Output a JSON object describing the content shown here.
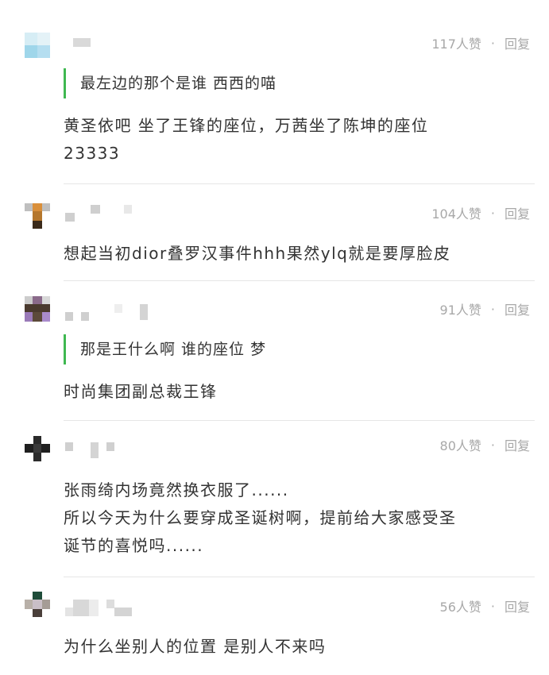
{
  "meta": {
    "reply_label": "回复",
    "separator": "·"
  },
  "comments": [
    {
      "likes": "117人赞",
      "quote": "最左边的那个是谁 西西的喵",
      "body": [
        "黄圣依吧 坐了王锋的座位，万茜坐了陈坤的座位",
        "23333"
      ]
    },
    {
      "likes": "104人赞",
      "body": [
        "想起当初dior叠罗汉事件hhh果然ylq就是要厚脸皮"
      ]
    },
    {
      "likes": "91人赞",
      "quote": "那是王什么啊 谁的座位 梦",
      "body": [
        "时尚集团副总裁王锋"
      ]
    },
    {
      "likes": "80人赞",
      "body": [
        "张雨绮内场竟然换衣服了......",
        "所以今天为什么要穿成圣诞树啊，提前给大家感受圣",
        "诞节的喜悦吗......"
      ]
    },
    {
      "likes": "56人赞",
      "body": [
        "为什么坐别人的位置 是别人不来吗"
      ]
    }
  ],
  "colors": {
    "accent_green": "#3fb851",
    "meta_gray": "#a8a8a8",
    "text": "#333333",
    "divider": "#e6e6e6"
  }
}
